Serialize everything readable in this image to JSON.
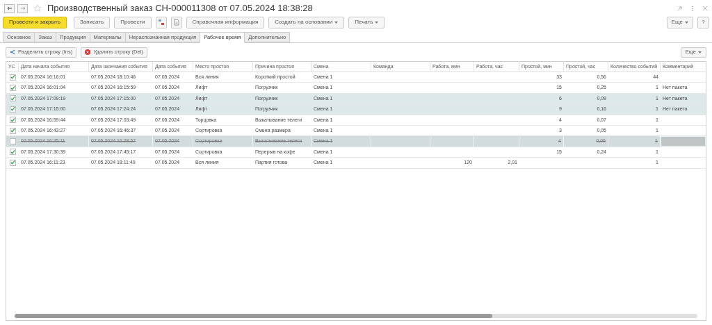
{
  "window": {
    "title": "Производственный заказ СН-000011308 от 07.05.2024 18:38:28",
    "favorite": false
  },
  "toolbar": {
    "buttons": [
      {
        "kind": "primary",
        "label": "Провести и закрыть"
      },
      {
        "kind": "text",
        "label": "Записать"
      },
      {
        "kind": "text",
        "label": "Провести"
      },
      {
        "kind": "icon-movements"
      },
      {
        "kind": "icon-report"
      },
      {
        "kind": "text",
        "label": "Справочная информация"
      },
      {
        "kind": "menu",
        "label": "Создать на основании"
      },
      {
        "kind": "menu",
        "label": "Печать"
      }
    ],
    "more": "Еще",
    "help": "?"
  },
  "tabs": [
    {
      "label": "Основное",
      "selected": false
    },
    {
      "label": "Заказ",
      "selected": false
    },
    {
      "label": "Продукция",
      "selected": false
    },
    {
      "label": "Материалы",
      "selected": false
    },
    {
      "label": "Нераспознанная продукция",
      "selected": false
    },
    {
      "label": "Рабочее время",
      "selected": true
    },
    {
      "label": "Дополнительно",
      "selected": false
    }
  ],
  "table_toolbar": {
    "split": "Разделить строку (Ins)",
    "delete": "Удалить строку (Del)",
    "more": "Еще"
  },
  "table": {
    "check_column": "УС",
    "columns": [
      "Дата начала события",
      "Дата окончания события",
      "Дата события",
      "Место простоя",
      "Причина простоя",
      "Смена",
      "Команда",
      "Работа, мин",
      "Работа, час",
      "Простой, мин",
      "Простой, час",
      "Количество событий",
      "Комментарий"
    ],
    "rows": [
      {
        "checked": true,
        "selected": false,
        "deleted": false,
        "cells": [
          "07.05.2024 16:16:01",
          "07.05.2024 18:10:46",
          "07.05.2024",
          "Вся линия",
          "Короткий простой",
          "Смена 1",
          "",
          "",
          "",
          "33",
          "0,56",
          "44",
          ""
        ]
      },
      {
        "checked": true,
        "selected": false,
        "deleted": false,
        "cells": [
          "07.05.2024 16:01:04",
          "07.05.2024 16:15:59",
          "07.05.2024",
          "Лифт",
          "Погрузчик",
          "Смена 1",
          "",
          "",
          "",
          "15",
          "0,25",
          "1",
          "Нет пакета"
        ]
      },
      {
        "checked": true,
        "selected": true,
        "deleted": false,
        "cells": [
          "07.05.2024 17:09:19",
          "07.05.2024 17:15:00",
          "07.05.2024",
          "Лифт",
          "Погрузчик",
          "Смена 1",
          "",
          "",
          "",
          "6",
          "0,09",
          "1",
          "Нет пакета"
        ]
      },
      {
        "checked": true,
        "selected": true,
        "deleted": false,
        "cells": [
          "07.05.2024 17:15:00",
          "07.05.2024 17:24:24",
          "07.05.2024",
          "Лифт",
          "Погрузчик",
          "Смена 1",
          "",
          "",
          "",
          "9",
          "0,16",
          "1",
          "Нет пакета"
        ]
      },
      {
        "checked": true,
        "selected": false,
        "deleted": false,
        "cells": [
          "07.05.2024 16:59:44",
          "07.05.2024 17:03:49",
          "07.05.2024",
          "Торцовка",
          "Выкатывание телеги",
          "Смена 1",
          "",
          "",
          "",
          "4",
          "0,07",
          "1",
          ""
        ]
      },
      {
        "checked": true,
        "selected": false,
        "deleted": false,
        "cells": [
          "07.05.2024 16:43:27",
          "07.05.2024 16:46:37",
          "07.05.2024",
          "Сортировка",
          "Смена размера",
          "Смена 1",
          "",
          "",
          "",
          "3",
          "0,05",
          "1",
          ""
        ]
      },
      {
        "checked": false,
        "selected": false,
        "deleted": true,
        "cells": [
          "07.05.2024 16:25:11",
          "07.05.2024 16:28:57",
          "07.05.2024",
          "Сортировка",
          "Выкатывание телеги",
          "Смена 1",
          "",
          "",
          "",
          "4",
          "0,06",
          "1",
          ""
        ]
      },
      {
        "checked": true,
        "selected": false,
        "deleted": false,
        "cells": [
          "07.05.2024 17:30:39",
          "07.05.2024 17:45:17",
          "07.05.2024",
          "Сортировка",
          "Перерыв на кофе",
          "Смена 1",
          "",
          "",
          "",
          "15",
          "0,24",
          "1",
          ""
        ]
      },
      {
        "checked": true,
        "selected": false,
        "deleted": false,
        "cells": [
          "07.05.2024 16:11:23",
          "07.05.2024 18:11:49",
          "07.05.2024",
          "Вся линия",
          "Партия готова",
          "Смена 1",
          "",
          "120",
          "2,01",
          "",
          "",
          "1",
          ""
        ]
      }
    ]
  }
}
